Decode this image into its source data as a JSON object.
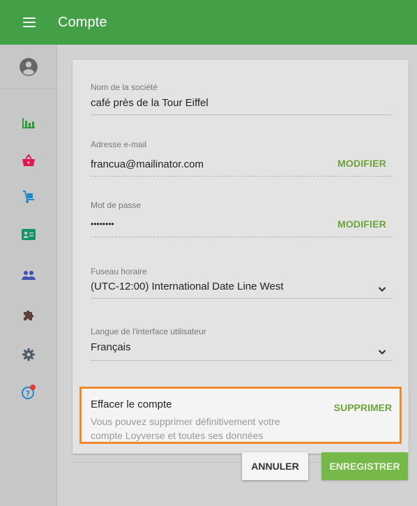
{
  "header": {
    "title": "Compte"
  },
  "sidebar": {
    "items": [
      {
        "icon": "account-circle-icon"
      },
      {
        "icon": "bar-chart-icon"
      },
      {
        "icon": "basket-icon"
      },
      {
        "icon": "dolly-icon"
      },
      {
        "icon": "id-card-icon"
      },
      {
        "icon": "people-icon"
      },
      {
        "icon": "puzzle-icon"
      },
      {
        "icon": "gear-icon"
      },
      {
        "icon": "help-icon"
      }
    ]
  },
  "form": {
    "company": {
      "label": "Nom de la société",
      "value": "café près de la Tour Eiffel"
    },
    "email": {
      "label": "Adresse e-mail",
      "value": "francua@mailinator.com",
      "action": "MODIFIER"
    },
    "password": {
      "label": "Mot de passe",
      "value": "••••••••",
      "action": "MODIFIER"
    },
    "timezone": {
      "label": "Fuseau horaire",
      "value": "(UTC-12:00) International Date Line West"
    },
    "language": {
      "label": "Langue de l'interface utilisateur",
      "value": "Français"
    }
  },
  "delete_account": {
    "title": "Effacer le compte",
    "description": "Vous pouvez supprimer définitivement votre compte Loyverse et toutes ses données",
    "action": "SUPPRIMER"
  },
  "buttons": {
    "cancel": "ANNULER",
    "save": "ENREGISTRER"
  },
  "colors": {
    "header": "#43a047",
    "accent": "#6ba33a",
    "highlight": "#f08a2c"
  }
}
